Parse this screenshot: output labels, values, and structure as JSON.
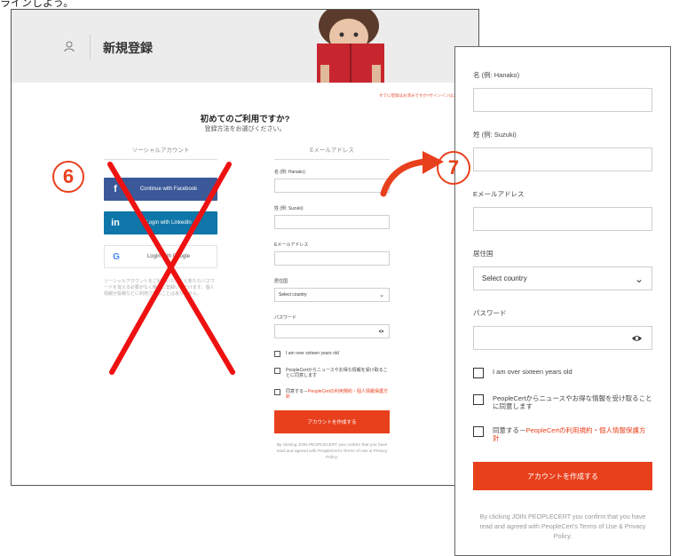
{
  "top_strip": {
    "text": "ラインしよう。"
  },
  "left": {
    "header_title": "新規登録",
    "top_link": "すでに登録はお済みですか?サインインはこちらから",
    "heading": "初めてのご利用ですか?",
    "subheading": "登録方法をお選びください。",
    "social_tab": "ソーシャルアカウント",
    "email_tab": "Eメールアドレス",
    "social_buttons": [
      {
        "icon": "f",
        "label": "Continue with Facebook"
      },
      {
        "icon": "in",
        "label": "Login with LinkedIn"
      },
      {
        "icon": "G",
        "label": "Login with Google"
      }
    ],
    "social_note": "ソーシャルアカウントをご利用いただくと新たなパスワードを覚える必要がなく簡単に登録いただけます。個人情報が投稿などに利用されることはありません。",
    "fields": {
      "first_name": "名 (例: Hanako)",
      "last_name": "姓 (例: Suzuki)",
      "email": "Eメールアドレス",
      "country": "居住国",
      "country_value": "Select country",
      "password": "パスワード"
    },
    "checks": {
      "age": "I am over sixteen years old",
      "news": "PeopleCertからニュースやお得な情報を受け取ることに同意します",
      "agree_pre": "同意する－",
      "agree_link": "PeopleCertの利用規約・個人情報保護方針"
    },
    "submit": "アカウントを作成する",
    "footer": "By clicking JOIN PEOPLECERT you confirm that you have read and agreed with PeopleCert's Terms of Use & Privacy Policy."
  },
  "badges": {
    "left": "6",
    "right": "7"
  },
  "right": {
    "first_name": "名 (例: Hanako)",
    "last_name": "姓 (例: Suzuki)",
    "email": "Eメールアドレス",
    "country": "居住国",
    "country_value": "Select country",
    "password": "パスワード",
    "age": "I am over sixteen years old",
    "news": "PeopleCertからニュースやお得な情報を受け取ることに同意します",
    "agree_pre": "同意する－",
    "agree_link": "PeopleCertの利用規約・個人情報保護方針",
    "submit": "アカウントを作成する",
    "footer": "By clicking JOIN PEOPLECERT you confirm that you have read and agreed with PeopleCert's Terms of Use & Privacy Policy."
  },
  "colors": {
    "accent": "#e8401c",
    "facebook": "#3b5998",
    "linkedin": "#0e76a8"
  },
  "icons": [
    "user-icon",
    "facebook-icon",
    "linkedin-icon",
    "google-icon",
    "chevron-down-icon",
    "eye-icon",
    "red-x-icon",
    "curved-arrow-icon"
  ]
}
